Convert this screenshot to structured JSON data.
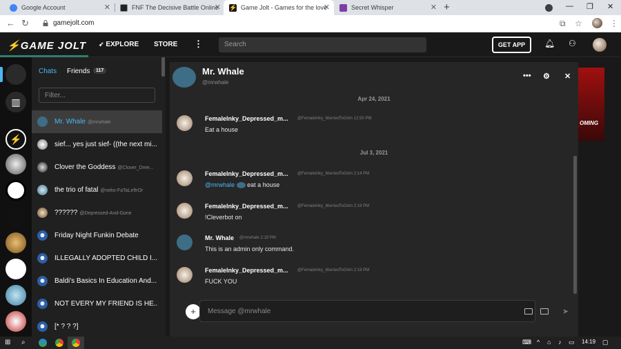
{
  "browser": {
    "tabs": [
      {
        "title": "Google Account",
        "color": "#4285f4"
      },
      {
        "title": "FNF The Decisive Battle Online - ...",
        "color": "#222222"
      },
      {
        "title": "Game Jolt - Games for the love o...",
        "color": "#1a1a1a"
      },
      {
        "title": "Secret Whisper",
        "color": "#7b3fa3"
      }
    ],
    "url": "gamejolt.com"
  },
  "header": {
    "logo": "GAME JOLT",
    "explore": "EXPLORE",
    "store": "STORE",
    "search_placeholder": "Search",
    "get_app": "GET APP"
  },
  "chats_panel": {
    "tab_chats": "Chats",
    "tab_friends": "Friends",
    "friends_count": "117",
    "filter_placeholder": "Filter...",
    "rooms": [
      {
        "name": "Mr. Whale",
        "handle": "@mrwhale",
        "active": true
      },
      {
        "name": "sief... yes just sief- ((the next mi...",
        "handle": ""
      },
      {
        "name": "Clover the Goddess",
        "handle": "@Clover_Dree..."
      },
      {
        "name": "the trio of fatal",
        "handle": "@neko-FaTaLeftrOr"
      },
      {
        "name": "??????",
        "handle": "@Depressed-And-Gone"
      },
      {
        "name": "Friday Night Funkin Debate",
        "handle": ""
      },
      {
        "name": "ILLEGALLY ADOPTED CHILD I...",
        "handle": ""
      },
      {
        "name": "Baldi's Basics In Education And...",
        "handle": ""
      },
      {
        "name": "NOT EVERY MY FRIEND IS HE...",
        "handle": ""
      },
      {
        "name": "[* ? ? ?]",
        "handle": ""
      }
    ]
  },
  "conversation": {
    "name": "Mr. Whale",
    "handle": "@mrwhale",
    "dates": [
      "Apr 24, 2021",
      "Jul 3, 2021"
    ],
    "messages": [
      {
        "author": "FemaleInky_Depressed_m...",
        "handle": "@FemaleInky_MarriedToGrim",
        "time": "12:50 PM",
        "text": "Eat a house"
      },
      {
        "author": "FemaleInky_Depressed_m...",
        "handle": "@FemaleInky_MarriedToGrim",
        "time": "2:14 PM",
        "mention": "@mrwhale",
        "text": " eat a house"
      },
      {
        "author": "FemaleInky_Depressed_m...",
        "handle": "@FemaleInky_MarriedToGrim",
        "time": "2:19 PM",
        "text": "!Cleverbot on"
      },
      {
        "author": "Mr. Whale",
        "handle": "@mrwhale",
        "time": "2:19 PM",
        "text": "This is an admin only command."
      },
      {
        "author": "FemaleInky_Depressed_m...",
        "handle": "@FemaleInky_MarriedToGrim",
        "time": "2:19 PM",
        "text": "FUCK YOU"
      }
    ],
    "input_placeholder": "Message @mrwhale"
  },
  "banner_text": "OMING",
  "taskbar": {
    "clock": "14:19"
  }
}
